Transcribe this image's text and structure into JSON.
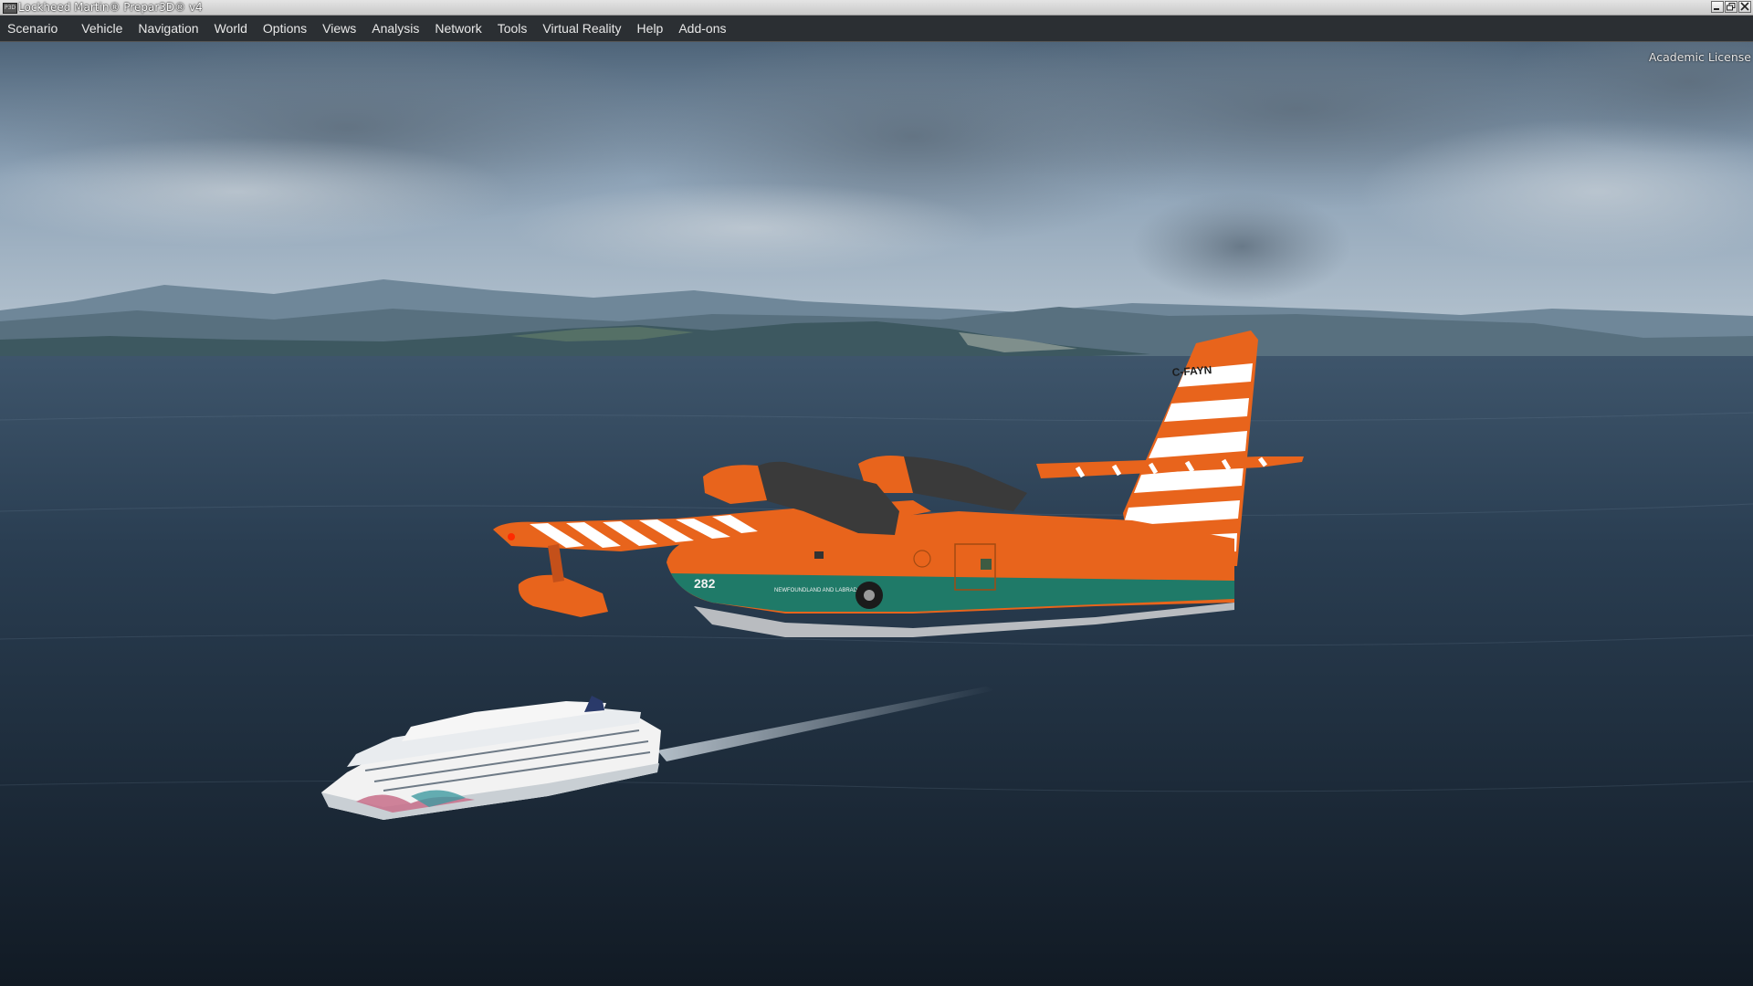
{
  "window": {
    "title": "Lockheed Martin® Prepar3D® v4",
    "icon": "p3d-app-icon"
  },
  "menubar": {
    "items": [
      {
        "label": "Scenario"
      },
      {
        "label": "Vehicle"
      },
      {
        "label": "Navigation"
      },
      {
        "label": "World"
      },
      {
        "label": "Options"
      },
      {
        "label": "Views"
      },
      {
        "label": "Analysis"
      },
      {
        "label": "Network"
      },
      {
        "label": "Tools"
      },
      {
        "label": "Virtual Reality"
      },
      {
        "label": "Help"
      },
      {
        "label": "Add-ons"
      }
    ]
  },
  "viewport": {
    "license_text": "Academic License",
    "aircraft": {
      "registration": "C-FAYN",
      "fleet_number": "282",
      "fuselage_text": "NEWFOUNDLAND AND LABRADOR",
      "livery_colors": {
        "primary": "#e8641c",
        "stripe": "#ffffff",
        "band": "#1f7a68"
      }
    },
    "colors": {
      "sky": "#7d93a8",
      "sea": "#1d2b3b",
      "land": "#3f5a5e"
    }
  }
}
